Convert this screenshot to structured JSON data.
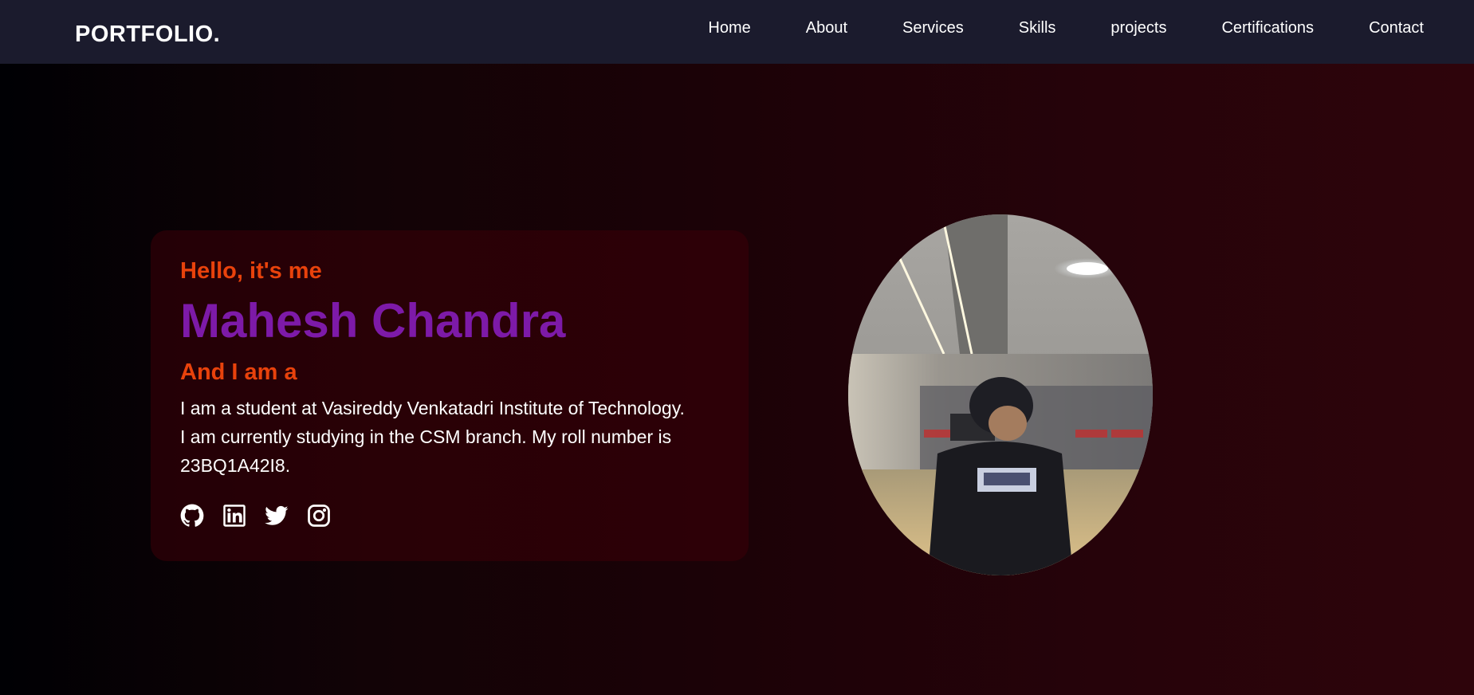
{
  "nav": {
    "logo": "PORTFOLIO.",
    "links": [
      "Home",
      "About",
      "Services",
      "Skills",
      "projects",
      "Certifications",
      "Contact"
    ]
  },
  "hero": {
    "greeting": "Hello, it's me",
    "name": "Mahesh Chandra",
    "role_prefix": "And I am a",
    "bio": "I am a student at Vasireddy Venkatadri Institute of Technology. I am currently studying in the CSM branch. My roll number is 23BQ1A42I8.",
    "socials": [
      "github-icon",
      "linkedin-icon",
      "twitter-icon",
      "instagram-icon"
    ]
  },
  "colors": {
    "accent_orange": "#e8420c",
    "accent_purple": "#7d1aa8",
    "navbar_bg": "#1b1b2d"
  }
}
